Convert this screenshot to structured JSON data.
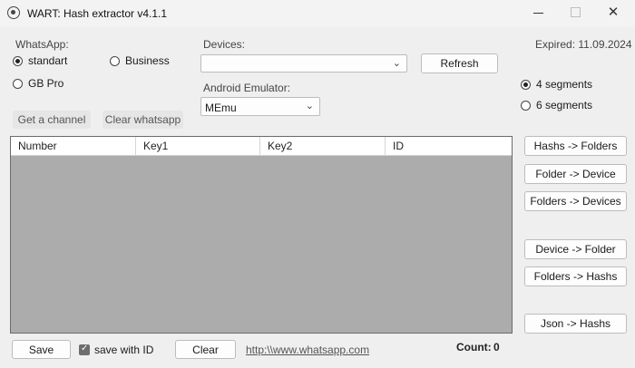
{
  "window": {
    "title": "WART: Hash extractor v4.1.1",
    "icon": "whatsapp-icon",
    "minimize": "minimize",
    "maximize": "maximize",
    "close": "✕"
  },
  "expired": "Expired: 11.09.2024",
  "whatsapp": {
    "label": "WhatsApp:",
    "options": [
      "standart",
      "Business",
      "GB Pro"
    ],
    "selected": "standart"
  },
  "devices": {
    "label": "Devices:",
    "value": "",
    "refresh": "Refresh"
  },
  "emulator": {
    "label": "Android Emulator:",
    "value": "MEmu"
  },
  "segments": {
    "options": [
      "4 segments",
      "6 segments"
    ],
    "selected": "4 segments"
  },
  "actions": {
    "get_channel": "Get a channel",
    "clear_whatsapp": "Clear whatsapp"
  },
  "table": {
    "columns": [
      "Number",
      "Key1",
      "Key2",
      "ID"
    ],
    "rows": []
  },
  "side_buttons": [
    "Hashs -> Folders",
    "Folder -> Device",
    "Folders -> Devices",
    "Device -> Folder",
    "Folders -> Hashs",
    "Json -> Hashs"
  ],
  "footer": {
    "save": "Save",
    "save_with_id": "save with ID",
    "save_with_id_checked": true,
    "clear": "Clear",
    "link": "http:\\\\www.whatsapp.com",
    "count_label": "Count:",
    "count_value": "0"
  }
}
